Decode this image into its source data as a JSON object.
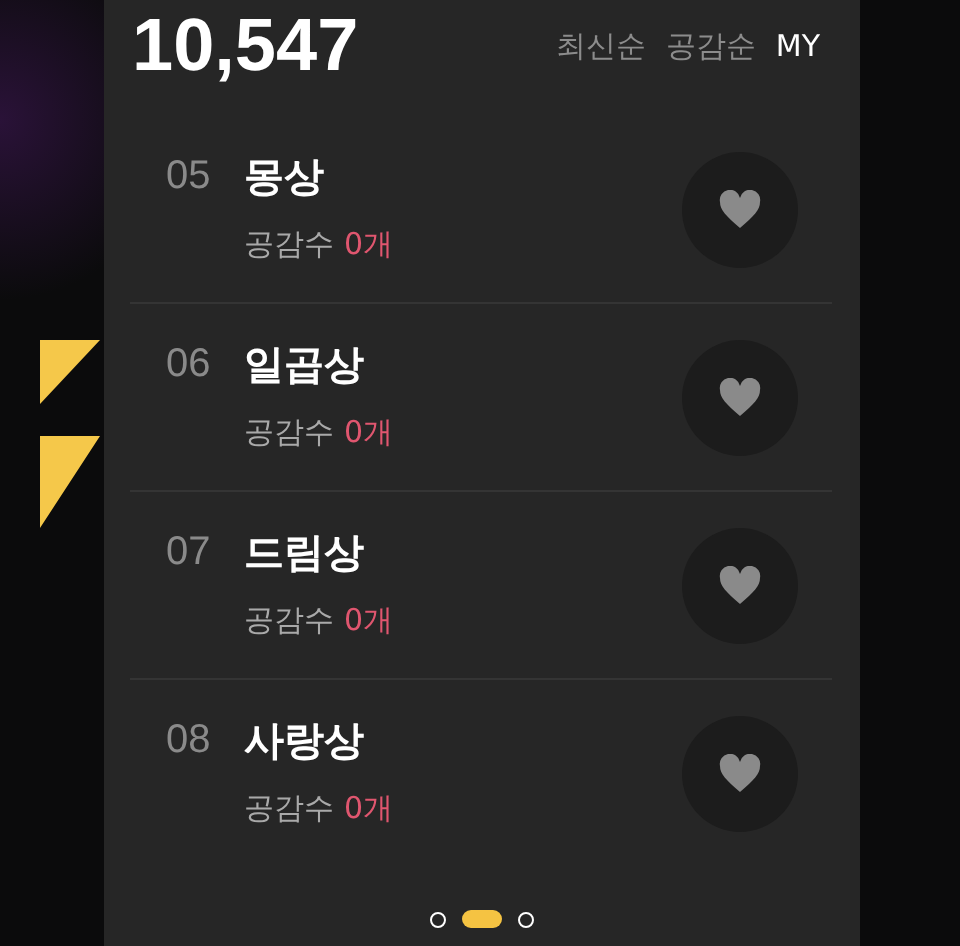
{
  "header": {
    "count": "10,547",
    "sort_tabs": [
      {
        "label": "최신순",
        "selected": false
      },
      {
        "label": "공감순",
        "selected": false
      },
      {
        "label": "MY",
        "selected": true
      }
    ]
  },
  "rows": [
    {
      "number": "05",
      "title": "몽상",
      "likes_label": "공감수",
      "likes_count": "0개",
      "liked": false
    },
    {
      "number": "06",
      "title": "일곱상",
      "likes_label": "공감수",
      "likes_count": "0개",
      "liked": false
    },
    {
      "number": "07",
      "title": "드림상",
      "likes_label": "공감수",
      "likes_count": "0개",
      "liked": false
    },
    {
      "number": "08",
      "title": "사랑상",
      "likes_label": "공감수",
      "likes_count": "0개",
      "liked": false
    }
  ],
  "pager": [
    {
      "selected": false
    },
    {
      "selected": true
    },
    {
      "selected": false
    }
  ]
}
